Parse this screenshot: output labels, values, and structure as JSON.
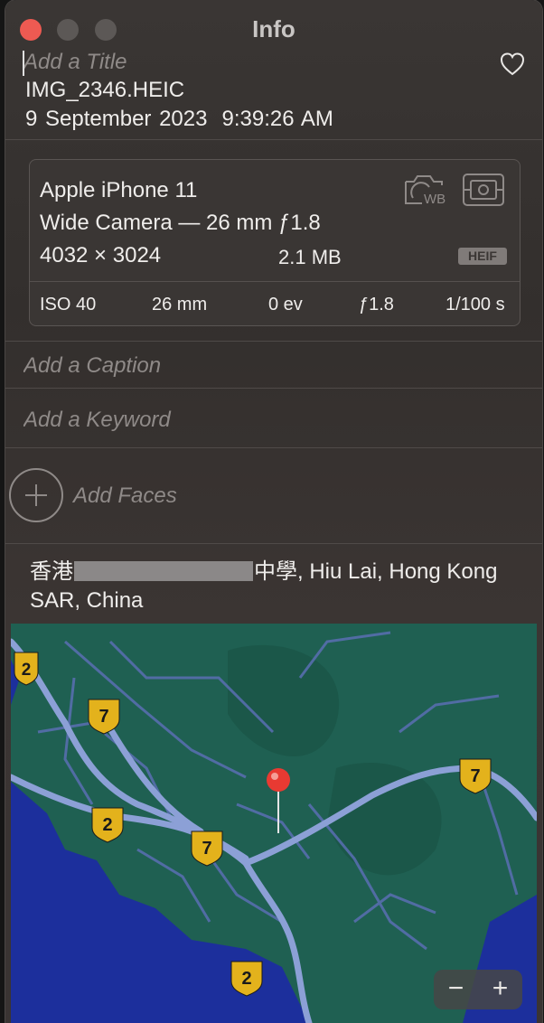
{
  "window": {
    "title": "Info"
  },
  "header": {
    "title_placeholder": "Add a Title",
    "filename": "IMG_2346.HEIC",
    "date": "9 September 2023",
    "time": "9:39:26 AM"
  },
  "camera": {
    "model": "Apple iPhone 11",
    "lens": "Wide Camera — 26 mm ƒ1.8",
    "dimensions": "4032 × 3024",
    "file_size": "2.1 MB",
    "format_badge": "HEIF",
    "wb_icon_text": "WB",
    "exif": {
      "iso": "ISO 40",
      "focal_length": "26 mm",
      "exposure": "0 ev",
      "aperture": "ƒ1.8",
      "shutter": "1/100 s"
    }
  },
  "fields": {
    "caption_placeholder": "Add a Caption",
    "keyword_placeholder": "Add a Keyword",
    "faces_label": "Add Faces"
  },
  "location": {
    "prefix": "香港",
    "suffix": "中學, Hiu Lai, Hong Kong SAR, China"
  },
  "map": {
    "route_shields": [
      {
        "number": "2"
      },
      {
        "number": "7"
      },
      {
        "number": "2"
      },
      {
        "number": "7"
      },
      {
        "number": "7"
      },
      {
        "number": "2"
      }
    ],
    "zoom_out": "−",
    "zoom_in": "+",
    "colors": {
      "land": "#1f6052",
      "water": "#1c2f9c",
      "roads": "#8ca0d6",
      "shield": "#e3b21c",
      "pin": "#e83a32"
    }
  }
}
